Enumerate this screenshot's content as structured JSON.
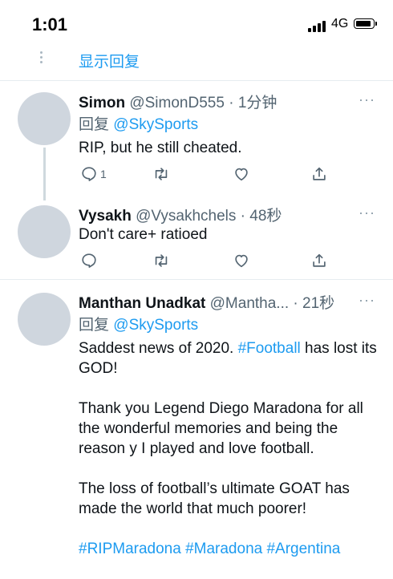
{
  "status_bar": {
    "time": "1:01",
    "network": "4G"
  },
  "show_replies_label": "显示回复",
  "tweets": [
    {
      "name": "Simon",
      "handle": "@SimonD555",
      "sep": "·",
      "time": "1分钟",
      "reply_label": "回复",
      "reply_to": "@SkySports",
      "text": "RIP, but he still cheated.",
      "reply_count": "1"
    },
    {
      "name": "Vysakh",
      "handle": "@Vysakhchels",
      "sep": "·",
      "time": "48秒",
      "text": "Don't care+ ratioed"
    },
    {
      "name": "Manthan Unadkat",
      "handle": "@Mantha...",
      "sep": "·",
      "time": "21秒",
      "reply_label": "回复",
      "reply_to": "@SkySports",
      "p1_a": "Saddest news of 2020. ",
      "p1_tag": "#Football",
      "p1_b": " has lost its GOD!",
      "p2": "Thank you Legend Diego Maradona for all the wonderful memories and being the reason y I played and love football.",
      "p3": "The loss of football’s ultimate GOAT has made the world that much poorer!",
      "hashtags": "#RIPMaradona #Maradona #Argentina"
    }
  ],
  "more_label": "···",
  "icons": [
    "reply-icon",
    "retweet-icon",
    "like-icon",
    "share-icon",
    "more-icon",
    "signal-icon",
    "battery-icon"
  ],
  "colors": {
    "accent": "#1d9bf0",
    "secondary_text": "#536471",
    "avatar": "#cfd6de"
  }
}
